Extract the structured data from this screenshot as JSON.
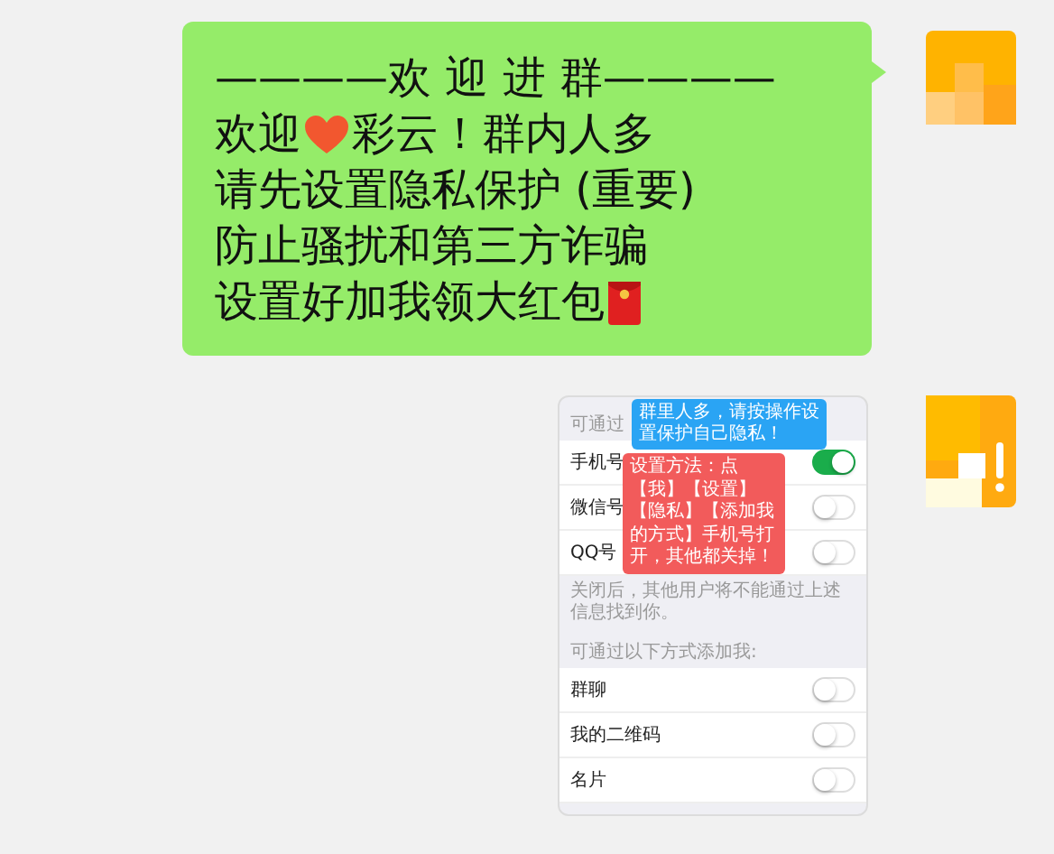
{
  "messages": [
    {
      "kind": "text",
      "lines": [
        [
          {
            "kind": "text",
            "text": "————欢 迎 进 群————"
          }
        ],
        [
          {
            "kind": "text",
            "text": "欢迎"
          },
          {
            "kind": "heart"
          },
          {
            "kind": "text",
            "text": "彩云！群内人多"
          }
        ],
        [
          {
            "kind": "text",
            "text": "请先设置隐私保护 (重要)"
          }
        ],
        [
          {
            "kind": "text",
            "text": "防止骚扰和第三方诈骗"
          }
        ],
        [
          {
            "kind": "text",
            "text": "设置好加我领大红包"
          },
          {
            "kind": "envelope"
          }
        ]
      ]
    },
    {
      "kind": "image",
      "sections": [
        {
          "header": "可通过",
          "rows": [
            {
              "label": "手机号",
              "on": true
            },
            {
              "label": "微信号",
              "on": false
            },
            {
              "label": "QQ号",
              "on": false
            }
          ],
          "note": "关闭后，其他用户将不能通过上述信息找到你。"
        },
        {
          "header": "可通过以下方式添加我:",
          "rows": [
            {
              "label": "群聊",
              "on": false
            },
            {
              "label": "我的二维码",
              "on": false
            },
            {
              "label": "名片",
              "on": false
            }
          ]
        }
      ],
      "callouts": [
        {
          "kind": "blue",
          "text": "群里人多，请按操作设置保护自己隐私！"
        },
        {
          "kind": "red",
          "text": "设置方法：点【我】【设置】【隐私】【添加我的方式】手机号打开，其他都关掉！"
        }
      ]
    }
  ]
}
